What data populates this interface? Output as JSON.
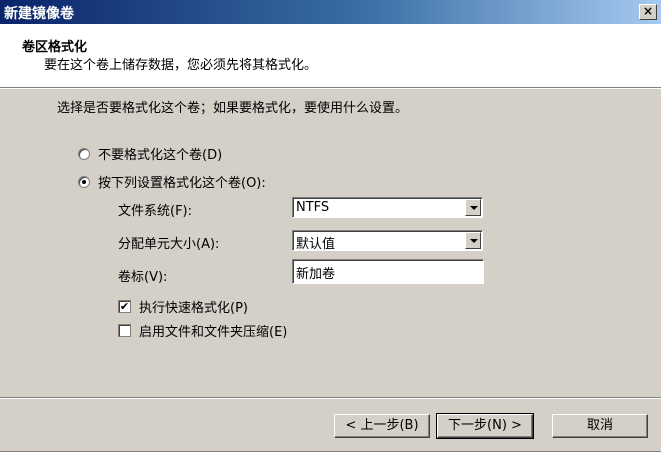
{
  "window": {
    "title": "新建镜像卷",
    "close_label": "×"
  },
  "header": {
    "title": "卷区格式化",
    "subtitle": "要在这个卷上储存数据，您必须先将其格式化。"
  },
  "prompt": "选择是否要格式化这个卷；如果要格式化，要使用什么设置。",
  "options": {
    "no_format": {
      "label": "不要格式化这个卷(D)",
      "selected": false
    },
    "format": {
      "label": "按下列设置格式化这个卷(O):",
      "selected": true
    }
  },
  "fields": {
    "filesystem": {
      "label": "文件系统(F):",
      "value": "NTFS"
    },
    "allocation": {
      "label": "分配单元大小(A):",
      "value": "默认值"
    },
    "volume_label": {
      "label": "卷标(V):",
      "value": "新加卷"
    }
  },
  "checks": {
    "quick_format": {
      "label": "执行快速格式化(P)",
      "checked": true,
      "mark": "✔"
    },
    "compression": {
      "label": "启用文件和文件夹压缩(E)",
      "checked": false,
      "mark": ""
    }
  },
  "buttons": {
    "back": "< 上一步(B)",
    "next": "下一步(N) >",
    "cancel": "取消"
  }
}
